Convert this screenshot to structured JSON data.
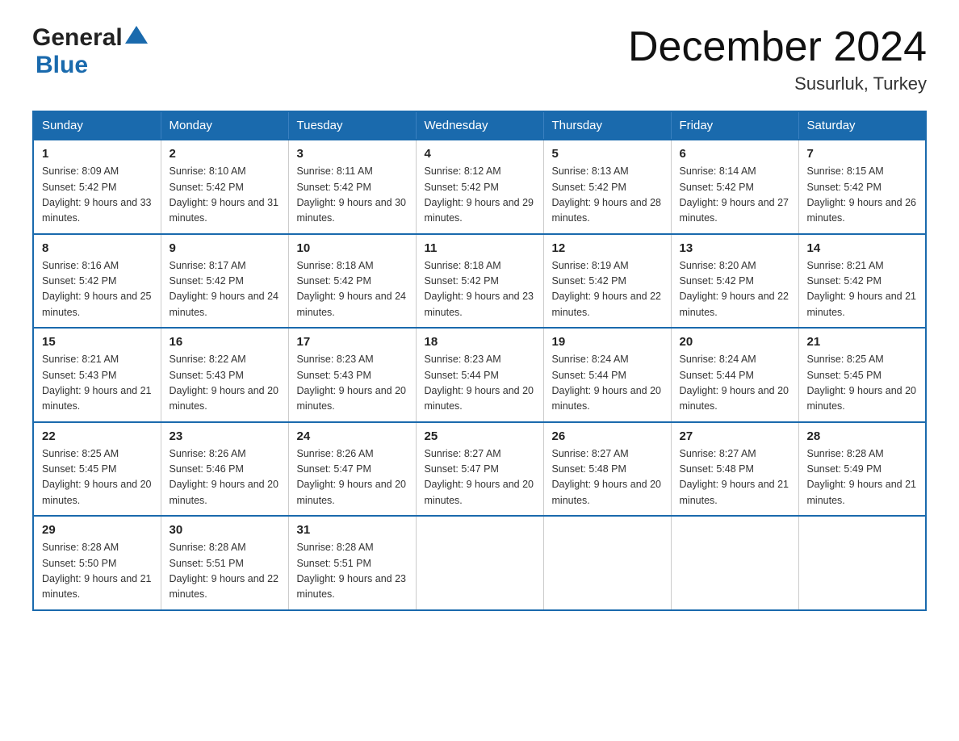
{
  "header": {
    "logo_general": "General",
    "logo_blue": "Blue",
    "title": "December 2024",
    "subtitle": "Susurluk, Turkey"
  },
  "days_of_week": [
    "Sunday",
    "Monday",
    "Tuesday",
    "Wednesday",
    "Thursday",
    "Friday",
    "Saturday"
  ],
  "weeks": [
    [
      {
        "num": "1",
        "sunrise": "8:09 AM",
        "sunset": "5:42 PM",
        "daylight": "9 hours and 33 minutes."
      },
      {
        "num": "2",
        "sunrise": "8:10 AM",
        "sunset": "5:42 PM",
        "daylight": "9 hours and 31 minutes."
      },
      {
        "num": "3",
        "sunrise": "8:11 AM",
        "sunset": "5:42 PM",
        "daylight": "9 hours and 30 minutes."
      },
      {
        "num": "4",
        "sunrise": "8:12 AM",
        "sunset": "5:42 PM",
        "daylight": "9 hours and 29 minutes."
      },
      {
        "num": "5",
        "sunrise": "8:13 AM",
        "sunset": "5:42 PM",
        "daylight": "9 hours and 28 minutes."
      },
      {
        "num": "6",
        "sunrise": "8:14 AM",
        "sunset": "5:42 PM",
        "daylight": "9 hours and 27 minutes."
      },
      {
        "num": "7",
        "sunrise": "8:15 AM",
        "sunset": "5:42 PM",
        "daylight": "9 hours and 26 minutes."
      }
    ],
    [
      {
        "num": "8",
        "sunrise": "8:16 AM",
        "sunset": "5:42 PM",
        "daylight": "9 hours and 25 minutes."
      },
      {
        "num": "9",
        "sunrise": "8:17 AM",
        "sunset": "5:42 PM",
        "daylight": "9 hours and 24 minutes."
      },
      {
        "num": "10",
        "sunrise": "8:18 AM",
        "sunset": "5:42 PM",
        "daylight": "9 hours and 24 minutes."
      },
      {
        "num": "11",
        "sunrise": "8:18 AM",
        "sunset": "5:42 PM",
        "daylight": "9 hours and 23 minutes."
      },
      {
        "num": "12",
        "sunrise": "8:19 AM",
        "sunset": "5:42 PM",
        "daylight": "9 hours and 22 minutes."
      },
      {
        "num": "13",
        "sunrise": "8:20 AM",
        "sunset": "5:42 PM",
        "daylight": "9 hours and 22 minutes."
      },
      {
        "num": "14",
        "sunrise": "8:21 AM",
        "sunset": "5:42 PM",
        "daylight": "9 hours and 21 minutes."
      }
    ],
    [
      {
        "num": "15",
        "sunrise": "8:21 AM",
        "sunset": "5:43 PM",
        "daylight": "9 hours and 21 minutes."
      },
      {
        "num": "16",
        "sunrise": "8:22 AM",
        "sunset": "5:43 PM",
        "daylight": "9 hours and 20 minutes."
      },
      {
        "num": "17",
        "sunrise": "8:23 AM",
        "sunset": "5:43 PM",
        "daylight": "9 hours and 20 minutes."
      },
      {
        "num": "18",
        "sunrise": "8:23 AM",
        "sunset": "5:44 PM",
        "daylight": "9 hours and 20 minutes."
      },
      {
        "num": "19",
        "sunrise": "8:24 AM",
        "sunset": "5:44 PM",
        "daylight": "9 hours and 20 minutes."
      },
      {
        "num": "20",
        "sunrise": "8:24 AM",
        "sunset": "5:44 PM",
        "daylight": "9 hours and 20 minutes."
      },
      {
        "num": "21",
        "sunrise": "8:25 AM",
        "sunset": "5:45 PM",
        "daylight": "9 hours and 20 minutes."
      }
    ],
    [
      {
        "num": "22",
        "sunrise": "8:25 AM",
        "sunset": "5:45 PM",
        "daylight": "9 hours and 20 minutes."
      },
      {
        "num": "23",
        "sunrise": "8:26 AM",
        "sunset": "5:46 PM",
        "daylight": "9 hours and 20 minutes."
      },
      {
        "num": "24",
        "sunrise": "8:26 AM",
        "sunset": "5:47 PM",
        "daylight": "9 hours and 20 minutes."
      },
      {
        "num": "25",
        "sunrise": "8:27 AM",
        "sunset": "5:47 PM",
        "daylight": "9 hours and 20 minutes."
      },
      {
        "num": "26",
        "sunrise": "8:27 AM",
        "sunset": "5:48 PM",
        "daylight": "9 hours and 20 minutes."
      },
      {
        "num": "27",
        "sunrise": "8:27 AM",
        "sunset": "5:48 PM",
        "daylight": "9 hours and 21 minutes."
      },
      {
        "num": "28",
        "sunrise": "8:28 AM",
        "sunset": "5:49 PM",
        "daylight": "9 hours and 21 minutes."
      }
    ],
    [
      {
        "num": "29",
        "sunrise": "8:28 AM",
        "sunset": "5:50 PM",
        "daylight": "9 hours and 21 minutes."
      },
      {
        "num": "30",
        "sunrise": "8:28 AM",
        "sunset": "5:51 PM",
        "daylight": "9 hours and 22 minutes."
      },
      {
        "num": "31",
        "sunrise": "8:28 AM",
        "sunset": "5:51 PM",
        "daylight": "9 hours and 23 minutes."
      },
      null,
      null,
      null,
      null
    ]
  ]
}
